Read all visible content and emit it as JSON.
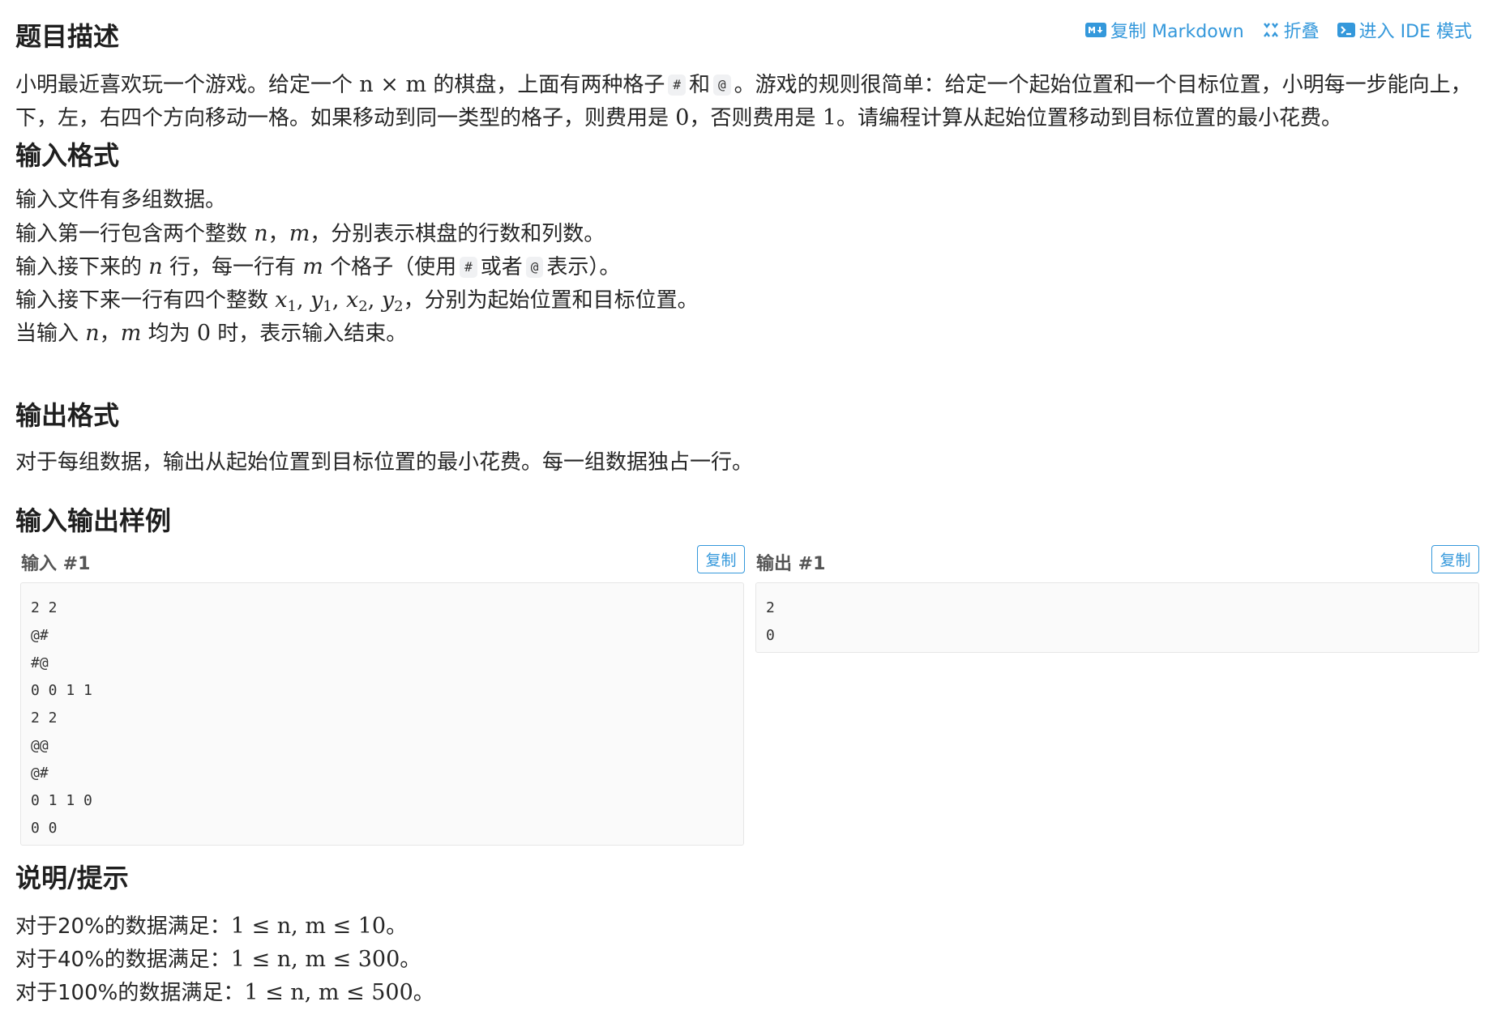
{
  "toolbar": {
    "copy_markdown": "复制 Markdown",
    "fold": "折叠",
    "ide_mode": "进入 IDE 模式",
    "icons": [
      "markdown-icon",
      "fold-icon",
      "terminal-icon"
    ],
    "accent_color": "#3498db"
  },
  "description": {
    "title": "题目描述",
    "line1": {
      "t1": "小明最近喜欢玩一个游戏。给定一个",
      "m1": "n × m",
      "t2": "的棋盘，上面有两种格子",
      "c1": "#",
      "t3": "和",
      "c2": "@",
      "t4": "。游戏的规则很简单：给定一个起始位置和一个目标位置，小明每一步能向上，"
    },
    "line2": {
      "t1": "下，左，右四个方向移动一格。如果移动到同一类型的格子，则费用是",
      "m1": "0",
      "t2": "，否则费用是",
      "m2": "1",
      "t3": "。请编程计算从起始位置移动到目标位置的最小花费。"
    }
  },
  "input_format": {
    "title": "输入格式",
    "line1": "输入文件有多组数据。",
    "line2": {
      "t1": "输入第一行包含两个整数",
      "m1": "n",
      "t2": "，",
      "m2": "m",
      "t3": "，分别表示棋盘的行数和列数。"
    },
    "line3": {
      "t1": "输入接下来的",
      "m1": "n",
      "t2": "行，每一行有",
      "m2": "m",
      "t3": "个格子（使用",
      "c1": "#",
      "t4": "或者",
      "c2": "@",
      "t5": "表示）。"
    },
    "line4": {
      "t1": "输入接下来一行有四个整数",
      "t2": "，分别为起始位置和目标位置。"
    },
    "line5": {
      "t1": "当输入",
      "m1": "n",
      "t2": "，",
      "m2": "m",
      "t3": "均为",
      "m3": "0",
      "t4": "时，表示输入结束。"
    }
  },
  "output_format": {
    "title": "输出格式",
    "line1": "对于每组数据，输出从起始位置到目标位置的最小花费。每一组数据独占一行。"
  },
  "samples": {
    "title": "输入输出样例",
    "copy_label": "复制",
    "input": {
      "label": "输入 #1",
      "lines": [
        "2 2",
        "@#",
        "#@",
        "0 0 1 1",
        "2 2",
        "@@",
        "@#",
        "0 1 1 0",
        "0 0"
      ]
    },
    "output": {
      "label": "输出 #1",
      "lines": [
        "2",
        "0"
      ]
    }
  },
  "hints": {
    "title": "说明/提示",
    "lines": [
      {
        "prefix": "对于20%的数据满足：",
        "math": "1 ≤ n, m ≤ 10",
        "suffix": "。"
      },
      {
        "prefix": "对于40%的数据满足：",
        "math": "1 ≤ n, m ≤ 300",
        "suffix": "。"
      },
      {
        "prefix": "对于100%的数据满足：",
        "math": "1 ≤ n, m ≤ 500",
        "suffix": "。"
      }
    ]
  }
}
